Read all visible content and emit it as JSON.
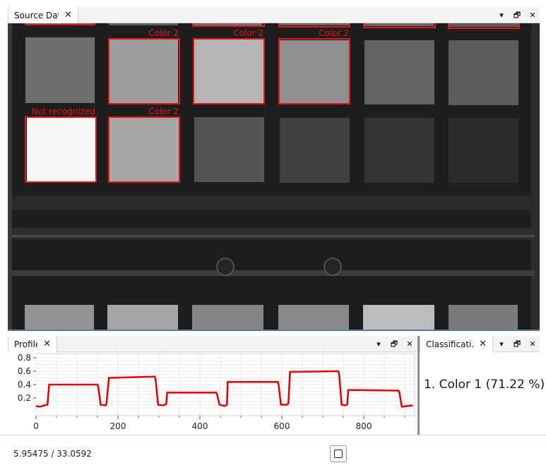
{
  "source_panel": {
    "tab_label": "Source Data",
    "close_glyph": "✕",
    "menu_glyph": "▾",
    "float_glyph": "🗗",
    "panel_close_glyph": "✕"
  },
  "profile_panel": {
    "tab_label": "Profile",
    "close_glyph": "✕",
    "menu_glyph": "▾",
    "float_glyph": "🗗",
    "panel_close_glyph": "✕"
  },
  "classification_panel": {
    "tab_label": "Classificati...",
    "close_glyph": "✕",
    "menu_glyph": "▾",
    "float_glyph": "🗗",
    "panel_close_glyph": "✕",
    "result": "1. Color 1 (71.22 %)"
  },
  "detections": [
    {
      "label": "Color 2",
      "row": 0,
      "col": 1
    },
    {
      "label": "Color 2",
      "row": 0,
      "col": 2
    },
    {
      "label": "Color 2",
      "row": 0,
      "col": 3
    },
    {
      "label": "Not recognized",
      "row": 1,
      "col": 0
    },
    {
      "label": "Color 2",
      "row": 1,
      "col": 1
    }
  ],
  "status": {
    "coordinates": "5.95475 / 33.0592"
  },
  "colors": {
    "detection": "#e8141a",
    "profile_line": "#e00000",
    "panel_bg": "#232323"
  },
  "chart_data": {
    "type": "line",
    "title": "",
    "xlabel": "",
    "ylabel": "",
    "xlim": [
      0,
      920
    ],
    "ylim": [
      0,
      0.9
    ],
    "xticks": [
      "0",
      "200",
      "400",
      "600",
      "800"
    ],
    "yticks": [
      "0.2",
      "0.4",
      "0.6",
      "0.8"
    ],
    "grid": true,
    "series": [
      {
        "x": [
          0,
          10,
          20,
          28,
          32,
          150,
          152,
          158,
          170,
          172,
          178,
          290,
          292,
          298,
          310,
          318,
          320,
          440,
          442,
          448,
          460,
          466,
          468,
          590,
          592,
          598,
          612,
          616,
          620,
          738,
          740,
          746,
          756,
          760,
          762,
          885,
          887,
          893,
          905,
          920
        ],
        "y": [
          0.08,
          0.07,
          0.09,
          0.1,
          0.4,
          0.4,
          0.36,
          0.1,
          0.09,
          0.12,
          0.5,
          0.52,
          0.47,
          0.1,
          0.09,
          0.11,
          0.28,
          0.28,
          0.25,
          0.1,
          0.08,
          0.1,
          0.44,
          0.44,
          0.4,
          0.1,
          0.1,
          0.12,
          0.59,
          0.6,
          0.55,
          0.1,
          0.09,
          0.11,
          0.32,
          0.31,
          0.28,
          0.07,
          0.08,
          0.09
        ]
      }
    ]
  }
}
